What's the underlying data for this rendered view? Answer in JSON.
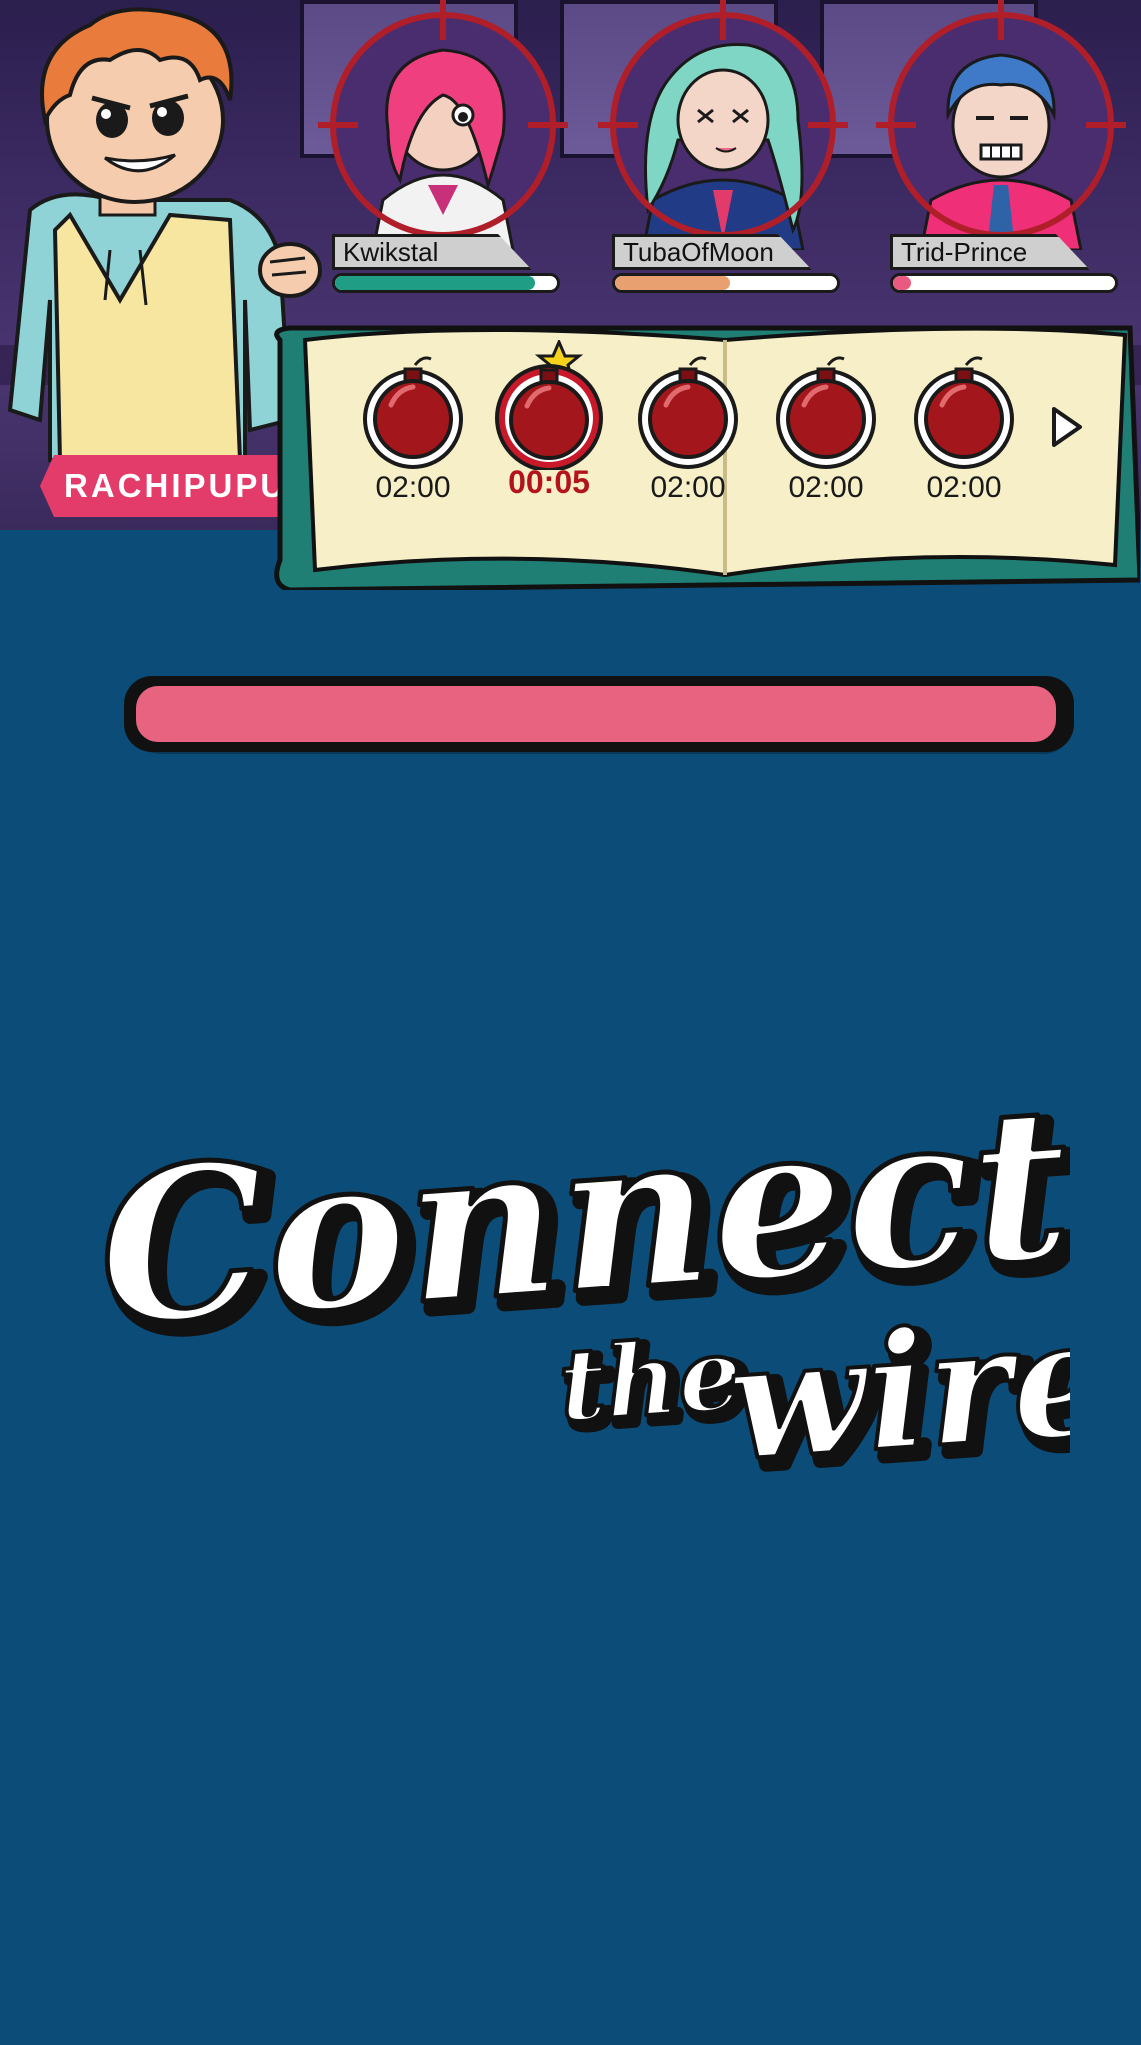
{
  "player": {
    "name": "RACHIPUPU"
  },
  "opponents": [
    {
      "name": "Kwikstal",
      "health": 0.9,
      "bar_color": "#1f9e85"
    },
    {
      "name": "TubaOfMoon",
      "health": 0.52,
      "bar_color": "#e8a070"
    },
    {
      "name": "Trid-Prince",
      "health": 0.08,
      "bar_color": "#e85a80"
    }
  ],
  "bombs": [
    {
      "timer": "02:00",
      "active": false
    },
    {
      "timer": "00:05",
      "active": true
    },
    {
      "timer": "02:00",
      "active": false
    },
    {
      "timer": "02:00",
      "active": false
    },
    {
      "timer": "02:00",
      "active": false
    }
  ],
  "task_progress": {
    "fill": 1.0,
    "color": "#e8637f"
  },
  "title": {
    "line1": "Connect",
    "line2a": "the",
    "line2b": "wire"
  },
  "icons": {
    "next": "chevron-right-icon",
    "bomb": "bomb-icon",
    "target": "crosshair-icon"
  },
  "colors": {
    "background": "#0b4d78",
    "accent": "#e33b6a",
    "book": "#f6efc7",
    "book_frame": "#3fa89a"
  }
}
